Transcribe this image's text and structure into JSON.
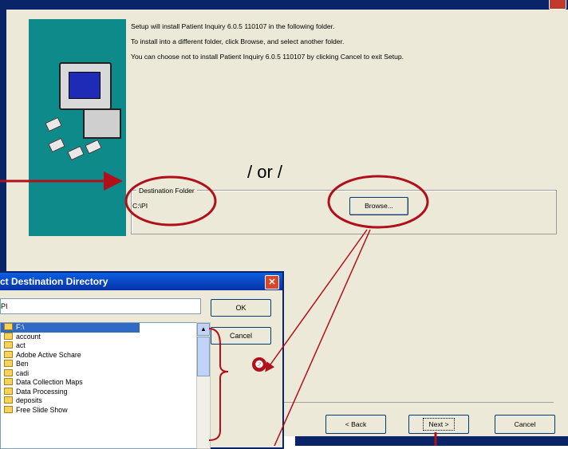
{
  "setup": {
    "line1": "Setup will install Patient Inquiry 6.0.5 110107 in the following folder.",
    "line2": "To install into a different folder, click Browse, and select another folder.",
    "line3": "You can choose not to install Patient Inquiry 6.0.5 110107 by clicking Cancel to exit Setup.",
    "dest_label": "Destination Folder",
    "dest_path": "C:\\PI",
    "browse_label": "Browse...",
    "back_label": "< Back",
    "next_label": "Next >",
    "cancel_label": "Cancel"
  },
  "annotation": {
    "or_text": "/ or /",
    "step_number": "❷"
  },
  "dialog": {
    "title": "ct Destination Directory",
    "path_value": "PI",
    "ok_label": "OK",
    "cancel_label": "Cancel",
    "folders": [
      "F:\\",
      "account",
      "act",
      "Adobe Active Schare",
      "Ben",
      "cadi",
      "Data Collection Maps",
      "Data Processing",
      "deposits",
      "Free Slide Show"
    ]
  },
  "colors": {
    "annotation": "#b0101a",
    "titlebar": "#0a246a",
    "wizard_panel": "#0e8a8a"
  }
}
